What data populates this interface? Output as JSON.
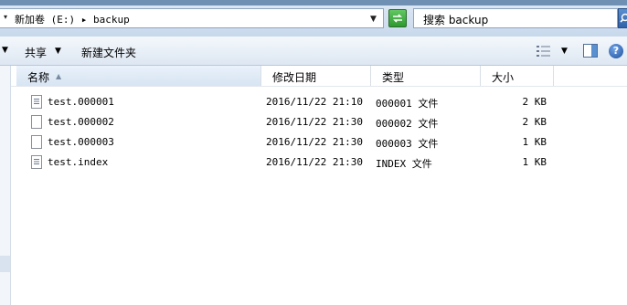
{
  "address": {
    "path": "新加卷 (E:) ▸ backup"
  },
  "search": {
    "text": "搜索 backup"
  },
  "toolbar": {
    "share_label": "共享",
    "new_folder_label": "新建文件夹"
  },
  "columns": {
    "name": "名称",
    "date": "修改日期",
    "type": "类型",
    "size": "大小"
  },
  "files": [
    {
      "name": "test.000001",
      "date": "2016/11/22 21:10",
      "type": "000001 文件",
      "size": "2 KB",
      "icon": "document-icon"
    },
    {
      "name": "test.000002",
      "date": "2016/11/22 21:30",
      "type": "000002 文件",
      "size": "2 KB",
      "icon": "blank-file-icon"
    },
    {
      "name": "test.000003",
      "date": "2016/11/22 21:30",
      "type": "000003 文件",
      "size": "1 KB",
      "icon": "blank-file-icon"
    },
    {
      "name": "test.index",
      "date": "2016/11/22 21:30",
      "type": "INDEX 文件",
      "size": "1 KB",
      "icon": "document-icon"
    }
  ],
  "icons": {
    "refresh": "refresh-icon",
    "search": "search-icon",
    "views": "views-icon",
    "preview_pane": "preview-pane-icon",
    "help": "help-icon"
  },
  "colors": {
    "titlebar": "#6f8fb3",
    "refresh": "#2e9a2e",
    "search_button": "#2f62a8"
  }
}
